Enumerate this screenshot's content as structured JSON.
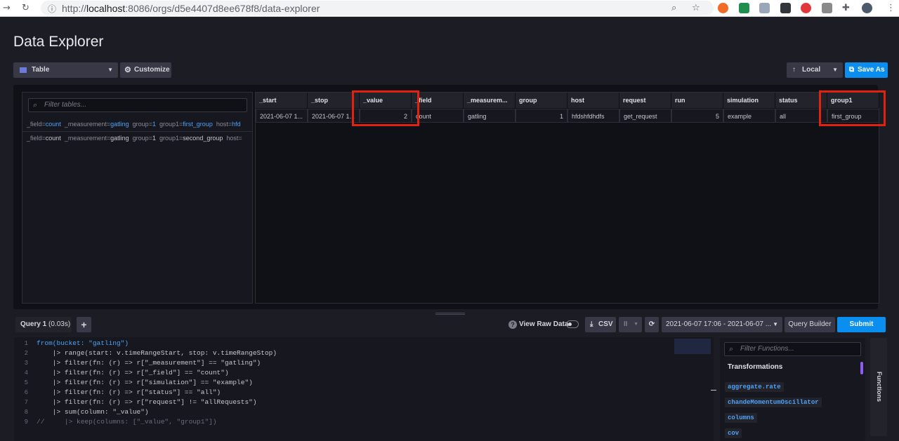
{
  "browser": {
    "url_prefix": "http://",
    "url_host": "localhost",
    "url_rest": ":8086/orgs/d5e4407d8ee678f8/data-explorer",
    "back_icon": "arrow-back-icon",
    "reload_icon": "reload-icon"
  },
  "page": {
    "title": "Data Explorer"
  },
  "toolbar": {
    "viz_type": "Table",
    "customize": "Customize",
    "source": "Local",
    "save_as": "Save As"
  },
  "tables_panel": {
    "filter_placeholder": "Filter tables...",
    "rows": [
      {
        "field": "count",
        "measurement": "gatling",
        "group": "1",
        "group1": "first_group",
        "host": "hfd"
      },
      {
        "field": "count",
        "measurement": "gatling",
        "group": "1",
        "group1": "second_group",
        "host": ""
      }
    ],
    "keys": {
      "field": "_field",
      "measurement": "_measurement",
      "group": "group",
      "group1": "group1",
      "host": "host"
    }
  },
  "table": {
    "columns": [
      "_start",
      "_stop",
      "_value",
      "_field",
      "_measurem...",
      "group",
      "host",
      "request",
      "run",
      "simulation",
      "status",
      "group1"
    ],
    "row": [
      "2021-06-07 1...",
      "2021-06-07 1...",
      "2",
      "count",
      "gatling",
      "1",
      "hfdshfdhdfs",
      "get_request",
      "5",
      "example",
      "all",
      "first_group"
    ]
  },
  "query_bar": {
    "query_tab": "Query 1",
    "query_time": "(0.03s)",
    "add_label": "+",
    "view_raw": "View Raw Data",
    "csv": "CSV",
    "pause": "II",
    "time_range": "2021-06-07 17:06 - 2021-06-07 ...",
    "query_builder": "Query Builder",
    "submit": "Submit"
  },
  "editor": {
    "lines": [
      "from(bucket: \"gatling\")",
      "    |> range(start: v.timeRangeStart, stop: v.timeRangeStop)",
      "    |> filter(fn: (r) => r[\"_measurement\"] == \"gatling\")",
      "    |> filter(fn: (r) => r[\"_field\"] == \"count\")",
      "    |> filter(fn: (r) => r[\"simulation\"] == \"example\")",
      "    |> filter(fn: (r) => r[\"status\"] == \"all\")",
      "    |> filter(fn: (r) => r[\"request\"] != \"allRequests\")",
      "    |> sum(column: \"_value\")",
      "//     |> keep(columns: [\"_value\", \"group1\"])"
    ]
  },
  "functions": {
    "filter_placeholder": "Filter Functions...",
    "category": "Transformations",
    "items": [
      "aggregate.rate",
      "chandeMomentumOscillator",
      "columns",
      "cov"
    ],
    "tab_label": "Functions"
  },
  "colors": {
    "accent": "#4ea2f7",
    "submit": "#0a8ef0",
    "highlight": "#e3210f"
  }
}
